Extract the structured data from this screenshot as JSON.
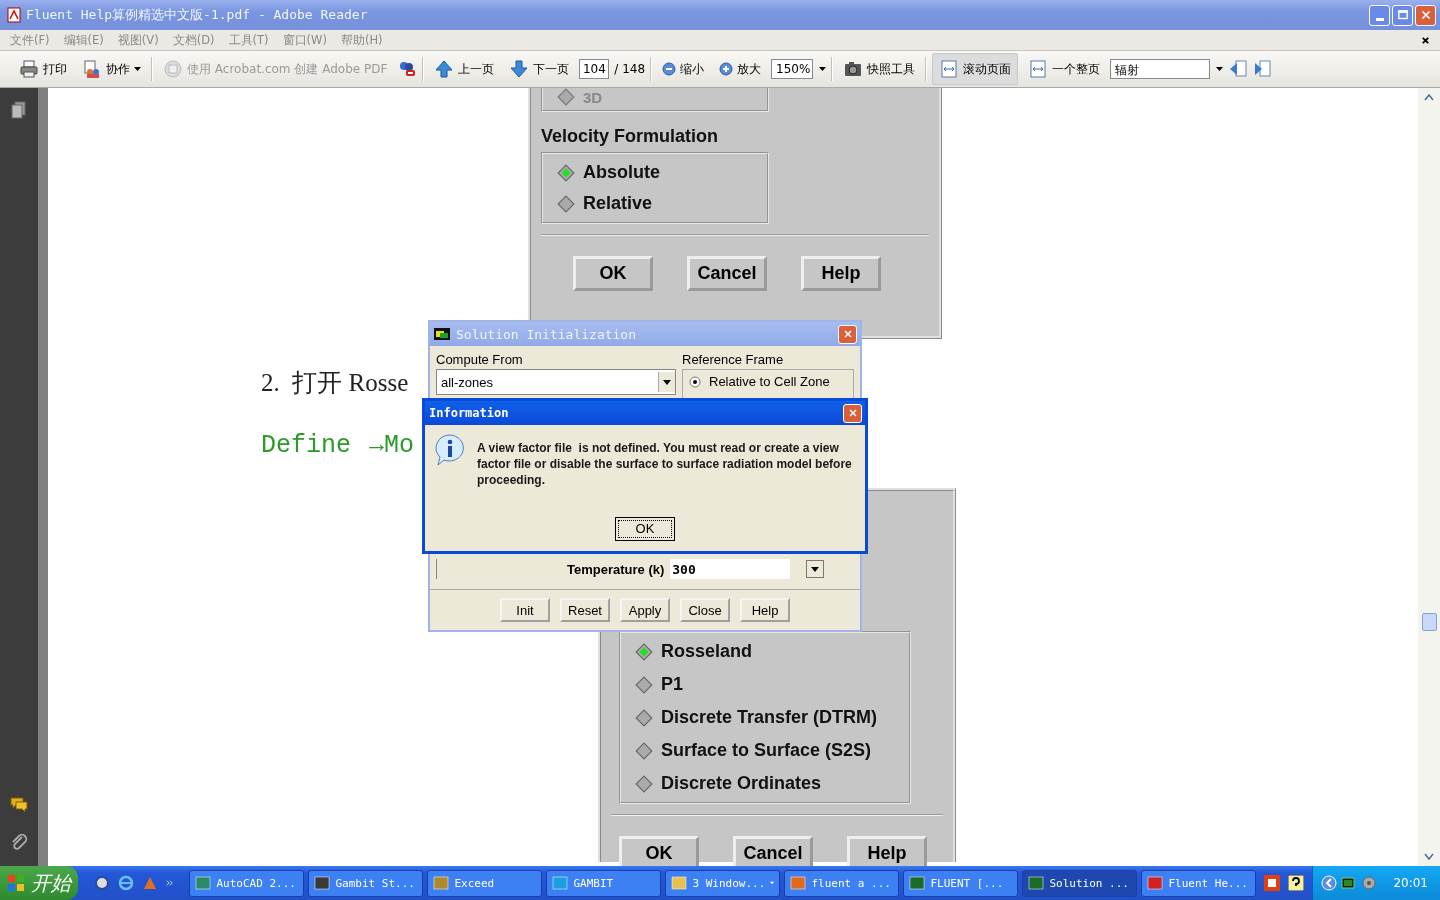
{
  "window": {
    "title": "Fluent Help算例精选中文版-1.pdf - Adobe Reader"
  },
  "menu": [
    "文件(F)",
    "编辑(E)",
    "视图(V)",
    "文档(D)",
    "工具(T)",
    "窗口(W)",
    "帮助(H)"
  ],
  "toolbar": {
    "print": "打印",
    "collaborate": "协作",
    "create_pdf": "使用 Acrobat.com 创建 Adobe PDF",
    "prev_page": "上一页",
    "next_page": "下一页",
    "page_number": "104",
    "page_total": "/ 148",
    "zoom_out": "缩小",
    "zoom_in": "放大",
    "zoom_value": "150%",
    "snapshot": "快照工具",
    "view_modes": [
      {
        "label": "滚动页面",
        "selected": true
      },
      {
        "label": "一个整页",
        "selected": false
      }
    ],
    "search_value": "辐射"
  },
  "document": {
    "top_panel": {
      "partial_option": "3D",
      "section": "Velocity Formulation",
      "options": [
        {
          "label": "Absolute",
          "selected": true
        },
        {
          "label": "Relative",
          "selected": false
        }
      ],
      "buttons": [
        "OK",
        "Cancel",
        "Help"
      ]
    },
    "step_text": "2.  打开 Rosse",
    "menu_path": [
      "Define",
      "→Mo"
    ],
    "bottom_panel": {
      "options": [
        {
          "label": "Rosseland",
          "selected": true
        },
        {
          "label": "P1",
          "selected": false
        },
        {
          "label": "Discrete Transfer (DTRM)",
          "selected": false
        },
        {
          "label": "Surface to Surface (S2S)",
          "selected": false
        },
        {
          "label": "Discrete Ordinates",
          "selected": false
        }
      ],
      "buttons": [
        "OK",
        "Cancel",
        "Help"
      ]
    }
  },
  "solution_dialog": {
    "title": "Solution Initialization",
    "compute_from_label": "Compute From",
    "compute_from_value": "all-zones",
    "reference_frame_label": "Reference Frame",
    "reference_options": [
      {
        "label": "Relative to Cell Zone",
        "selected": true
      }
    ],
    "temperature_label": "Temperature (k)",
    "temperature_value": "300",
    "buttons": [
      "Init",
      "Reset",
      "Apply",
      "Close",
      "Help"
    ]
  },
  "info_dialog": {
    "title": "Information",
    "message": "A view factor file  is not defined. You must read or create a view factor file or disable the surface to surface radiation model before proceeding.",
    "button": "OK"
  },
  "taskbar": {
    "start": "开始",
    "tasks": [
      {
        "label": "AutoCAD 2...",
        "kind": "cad",
        "selected": false
      },
      {
        "label": "Gambit St...",
        "kind": "gambit",
        "selected": false
      },
      {
        "label": "Exceed",
        "kind": "exceed",
        "selected": false
      },
      {
        "label": "GAMBIT",
        "kind": "cross",
        "selected": false
      },
      {
        "label": "3 Window...",
        "kind": "folder",
        "selected": false
      },
      {
        "label": "fluent a ...",
        "kind": "browser",
        "selected": false
      },
      {
        "label": "FLUENT  [...",
        "kind": "fluent",
        "selected": false
      },
      {
        "label": "Solution ...",
        "kind": "fluent",
        "selected": true
      },
      {
        "label": "Fluent He...",
        "kind": "pdf",
        "selected": false
      }
    ],
    "clock": "20:01"
  }
}
